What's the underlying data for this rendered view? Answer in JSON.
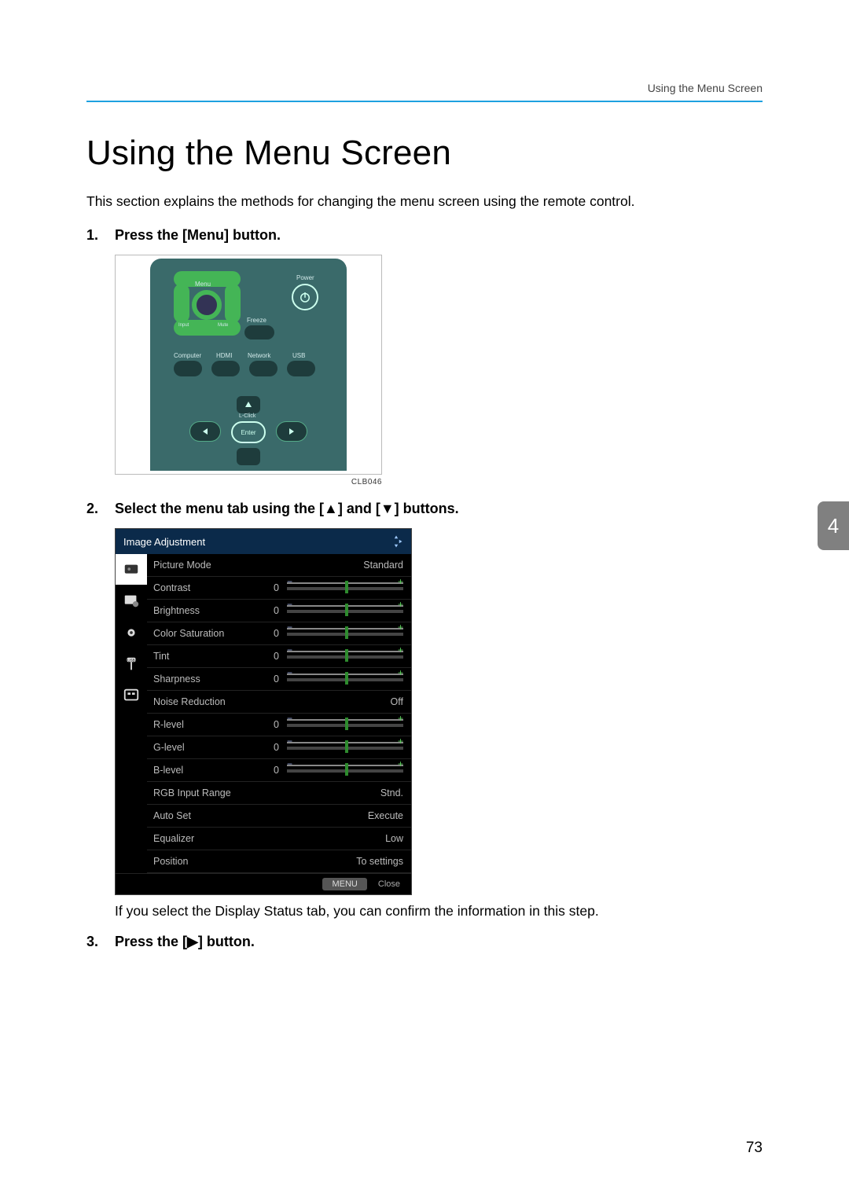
{
  "header": {
    "running": "Using the Menu Screen"
  },
  "title": "Using the Menu Screen",
  "intro": "This section explains the methods for changing the menu screen using the remote control.",
  "chapter_tab": "4",
  "page_number": "73",
  "steps": [
    {
      "title": "Press the [Menu] button.",
      "figure_caption": "CLB046",
      "remote": {
        "menu_label": "Menu",
        "input_label": "Input",
        "mute_label": "Mute",
        "freeze_label": "Freeze",
        "power_label": "Power",
        "computer_label": "Computer",
        "hdmi_label": "HDMI",
        "network_label": "Network",
        "usb_label": "USB",
        "lclick_label": "L-Click",
        "enter_label": "Enter"
      }
    },
    {
      "title": "Select the menu tab using the [▲] and [▼] buttons.",
      "osd": {
        "title": "Image Adjustment",
        "rows": [
          {
            "label": "Picture Mode",
            "rhs": "Standard"
          },
          {
            "label": "Contrast",
            "val": "0",
            "slider": true
          },
          {
            "label": "Brightness",
            "val": "0",
            "slider": true
          },
          {
            "label": "Color Saturation",
            "val": "0",
            "slider": true
          },
          {
            "label": "Tint",
            "val": "0",
            "slider": true
          },
          {
            "label": "Sharpness",
            "val": "0",
            "slider": true
          },
          {
            "label": "Noise Reduction",
            "rhs": "Off"
          },
          {
            "label": "R-level",
            "val": "0",
            "slider": true
          },
          {
            "label": "G-level",
            "val": "0",
            "slider": true
          },
          {
            "label": "B-level",
            "val": "0",
            "slider": true
          },
          {
            "label": "RGB Input Range",
            "rhs": "Stnd."
          },
          {
            "label": "Auto Set",
            "rhs": "Execute"
          },
          {
            "label": "Equalizer",
            "rhs": "Low"
          },
          {
            "label": "Position",
            "rhs": "To settings"
          }
        ],
        "footer_menu": "MENU",
        "footer_close": "Close"
      },
      "body": "If you select the Display Status tab, you can confirm the information in this step."
    },
    {
      "title": "Press the [▶] button."
    }
  ]
}
